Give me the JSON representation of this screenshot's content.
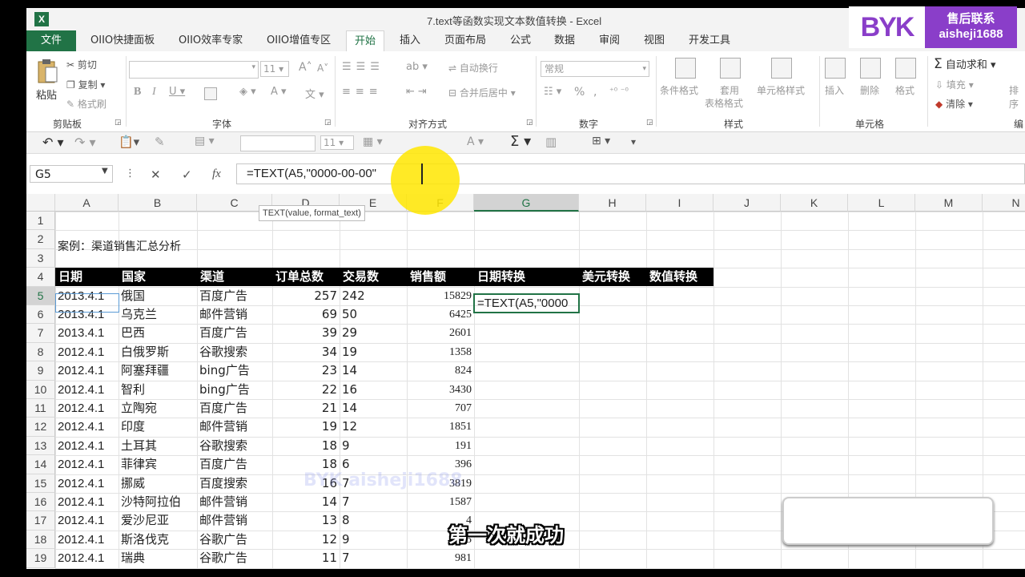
{
  "window": {
    "title": "7.text等函数实现文本数值转换 - Excel",
    "logo": "X"
  },
  "tabs": [
    {
      "label": "文件"
    },
    {
      "label": "OIIO快捷面板"
    },
    {
      "label": "OIIO效率专家"
    },
    {
      "label": "OIIO增值专区"
    },
    {
      "label": "开始"
    },
    {
      "label": "插入"
    },
    {
      "label": "页面布局"
    },
    {
      "label": "公式"
    },
    {
      "label": "数据"
    },
    {
      "label": "审阅"
    },
    {
      "label": "视图"
    },
    {
      "label": "开发工具"
    }
  ],
  "ribbon": {
    "clipboard": {
      "paste": "粘贴",
      "cut": "剪切",
      "copy": "复制",
      "format_painter": "格式刷",
      "label": "剪贴板"
    },
    "font": {
      "size": "11",
      "label": "字体"
    },
    "alignment": {
      "wrap": "自动换行",
      "merge": "合并后居中",
      "label": "对齐方式"
    },
    "number": {
      "format": "常规",
      "label": "数字"
    },
    "styles": {
      "conditional": "条件格式",
      "table_line1": "套用",
      "table_line2": "表格格式",
      "cell_styles": "单元格样式",
      "label": "样式"
    },
    "cells": {
      "insert": "插入",
      "delete": "删除",
      "format": "格式",
      "label": "单元格"
    },
    "editing": {
      "autosum": "自动求和",
      "fill": "填充",
      "clear": "清除",
      "sort": "排序",
      "label": "编"
    }
  },
  "qat": {
    "font_size": "11"
  },
  "formula_bar": {
    "name_box": "G5",
    "formula": "=TEXT(A5,\"0000-00-00\"",
    "tooltip": "TEXT(value, format_text)"
  },
  "columns": [
    "A",
    "B",
    "C",
    "D",
    "E",
    "F",
    "G",
    "H",
    "I",
    "J",
    "K",
    "L",
    "M",
    "N"
  ],
  "rows": [
    "1",
    "2",
    "3",
    "4",
    "5",
    "6",
    "7",
    "8",
    "9",
    "10",
    "11",
    "12",
    "13",
    "14",
    "15",
    "16",
    "17",
    "18",
    "19"
  ],
  "sheet": {
    "case_title": "案例：渠道销售汇总分析",
    "headers": [
      "日期",
      "国家",
      "渠道",
      "订单总数",
      "交易数",
      "销售额",
      "日期转换",
      "美元转换",
      "数值转换"
    ],
    "active_cell_text": "=TEXT(A5,\"0000",
    "data": [
      [
        "2013.4.1",
        "俄国",
        "百度广告",
        "257",
        "242",
        "15829"
      ],
      [
        "2013.4.1",
        "乌克兰",
        "邮件营销",
        "69",
        "50",
        "6425"
      ],
      [
        "2013.4.1",
        "巴西",
        "百度广告",
        "39",
        "29",
        "2601"
      ],
      [
        "2012.4.1",
        "白俄罗斯",
        "谷歌搜索",
        "34",
        "19",
        "1358"
      ],
      [
        "2012.4.1",
        "阿塞拜疆",
        "bing广告",
        "23",
        "14",
        "824"
      ],
      [
        "2012.4.1",
        "智利",
        "bing广告",
        "22",
        "16",
        "3430"
      ],
      [
        "2012.4.1",
        "立陶宛",
        "百度广告",
        "21",
        "14",
        "707"
      ],
      [
        "2012.4.1",
        "印度",
        "邮件营销",
        "19",
        "12",
        "1851"
      ],
      [
        "2012.4.1",
        "土耳其",
        "谷歌搜索",
        "18",
        "9",
        "191"
      ],
      [
        "2012.4.1",
        "菲律宾",
        "百度广告",
        "18",
        "6",
        "396"
      ],
      [
        "2012.4.1",
        "挪威",
        "百度搜索",
        "16",
        "7",
        "3819"
      ],
      [
        "2012.4.1",
        "沙特阿拉伯",
        "邮件营销",
        "14",
        "7",
        "1587"
      ],
      [
        "2012.4.1",
        "爱沙尼亚",
        "邮件营销",
        "13",
        "8",
        "4"
      ],
      [
        "2012.4.1",
        "斯洛伐克",
        "谷歌广告",
        "12",
        "9",
        "5"
      ],
      [
        "2012.4.1",
        "瑞典",
        "谷歌广告",
        "11",
        "7",
        "981"
      ]
    ]
  },
  "overlay": {
    "brand": "BYK",
    "contact_label": "售后联系",
    "contact_id": "aisheji1688",
    "subtitle": "第一次就成功",
    "watermark": "BYK aisheji1688"
  }
}
